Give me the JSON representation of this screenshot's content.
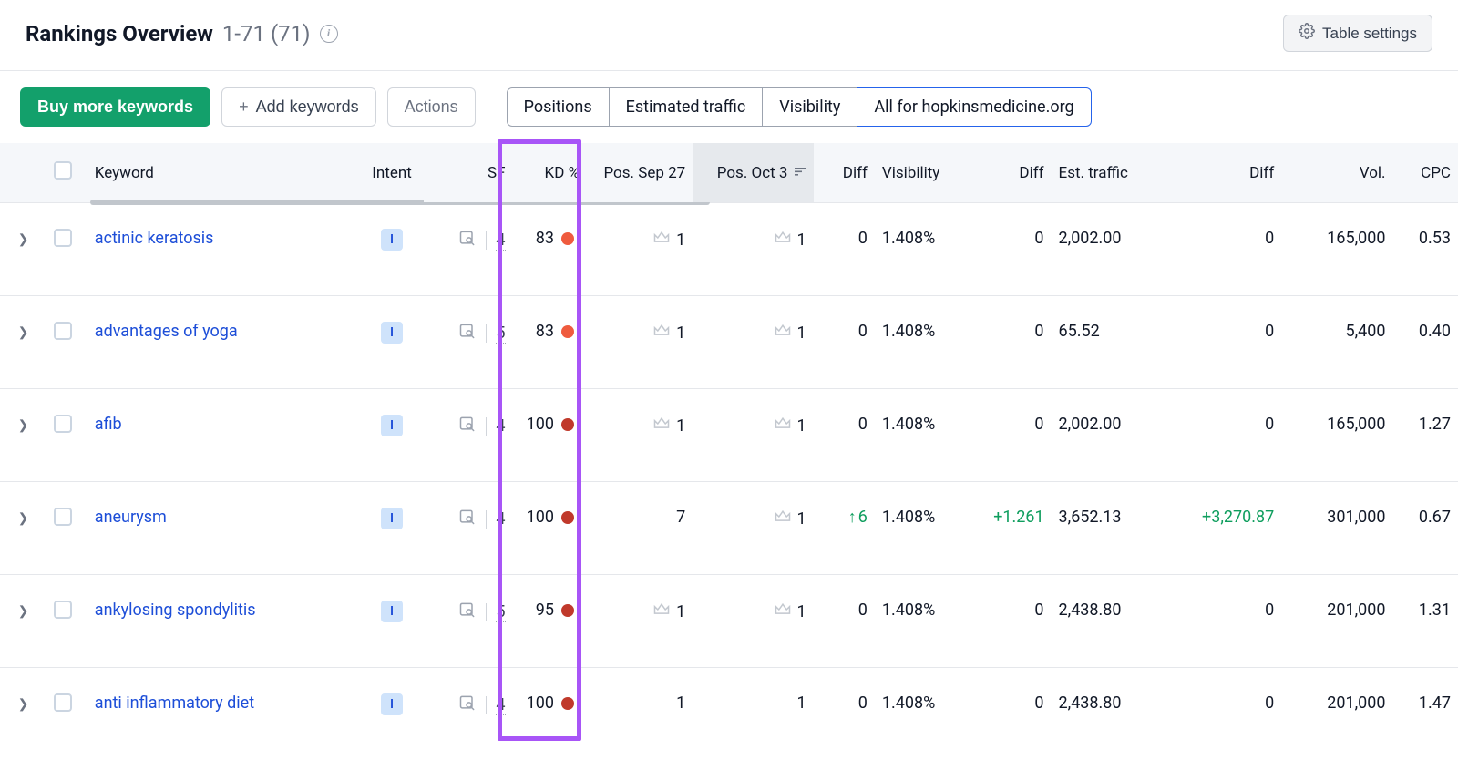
{
  "header": {
    "title": "Rankings Overview",
    "range": "1-71 (71)",
    "table_settings": "Table settings"
  },
  "toolbar": {
    "buy": "Buy more keywords",
    "add": "Add keywords",
    "actions": "Actions",
    "tabs": {
      "positions": "Positions",
      "traffic": "Estimated traffic",
      "visibility": "Visibility",
      "all_for": "All for hopkinsmedicine.org"
    }
  },
  "columns": {
    "keyword": "Keyword",
    "intent": "Intent",
    "sf": "SF",
    "kd": "KD %",
    "pos_sep27": "Pos. Sep 27",
    "pos_oct3": "Pos. Oct 3",
    "diff": "Diff",
    "visibility": "Visibility",
    "diff2": "Diff",
    "est_traffic": "Est. traffic",
    "diff3": "Diff",
    "vol": "Vol.",
    "cpc": "CPC"
  },
  "rows": [
    {
      "keyword": "actinic keratosis",
      "intent": "I",
      "sf": "4",
      "kd": "83",
      "kd_color": "#ef5b3e",
      "pos1": "1",
      "pos1_crown": true,
      "pos2": "1",
      "pos2_crown": true,
      "diff1": "0",
      "visibility": "1.408%",
      "diff2": "0",
      "est": "2,002.00",
      "diff3": "0",
      "vol": "165,000",
      "cpc": "0.53"
    },
    {
      "keyword": "advantages of yoga",
      "intent": "I",
      "sf": "5",
      "kd": "83",
      "kd_color": "#ef5b3e",
      "pos1": "1",
      "pos1_crown": true,
      "pos2": "1",
      "pos2_crown": true,
      "diff1": "0",
      "visibility": "1.408%",
      "diff2": "0",
      "est": "65.52",
      "diff3": "0",
      "vol": "5,400",
      "cpc": "0.40"
    },
    {
      "keyword": "afib",
      "intent": "I",
      "sf": "4",
      "kd": "100",
      "kd_color": "#c0392b",
      "pos1": "1",
      "pos1_crown": true,
      "pos2": "1",
      "pos2_crown": true,
      "diff1": "0",
      "visibility": "1.408%",
      "diff2": "0",
      "est": "2,002.00",
      "diff3": "0",
      "vol": "165,000",
      "cpc": "1.27"
    },
    {
      "keyword": "aneurysm",
      "intent": "I",
      "sf": "4",
      "kd": "100",
      "kd_color": "#c0392b",
      "pos1": "7",
      "pos1_crown": false,
      "pos2": "1",
      "pos2_crown": true,
      "diff1": "6",
      "diff1_up": true,
      "visibility": "1.408%",
      "diff2": "+1.261",
      "diff2_pos": true,
      "est": "3,652.13",
      "diff3": "+3,270.87",
      "diff3_pos": true,
      "vol": "301,000",
      "cpc": "0.67"
    },
    {
      "keyword": "ankylosing spondylitis",
      "intent": "I",
      "sf": "5",
      "kd": "95",
      "kd_color": "#c0392b",
      "pos1": "1",
      "pos1_crown": true,
      "pos2": "1",
      "pos2_crown": true,
      "diff1": "0",
      "visibility": "1.408%",
      "diff2": "0",
      "est": "2,438.80",
      "diff3": "0",
      "vol": "201,000",
      "cpc": "1.31"
    },
    {
      "keyword": "anti inflammatory diet",
      "intent": "I",
      "sf": "4",
      "kd": "100",
      "kd_color": "#c0392b",
      "pos1": "1",
      "pos1_crown": false,
      "pos2": "1",
      "pos2_crown": false,
      "diff1": "0",
      "visibility": "1.408%",
      "diff2": "0",
      "est": "2,438.80",
      "diff3": "0",
      "vol": "201,000",
      "cpc": "1.47"
    }
  ]
}
